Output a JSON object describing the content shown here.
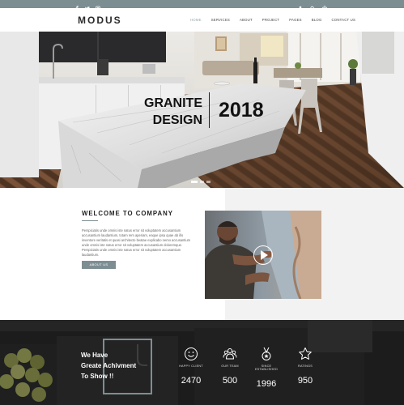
{
  "topbar": {
    "social_icons": [
      "facebook-icon",
      "twitter-icon",
      "instagram-icon"
    ],
    "tool_icons": [
      "user-icon",
      "search-icon",
      "cart-icon"
    ]
  },
  "header": {
    "logo": "MODUS",
    "nav": [
      {
        "label": "HOME",
        "active": true
      },
      {
        "label": "SERVICES",
        "active": false
      },
      {
        "label": "ABOUT",
        "active": false
      },
      {
        "label": "PROJECT",
        "active": false
      },
      {
        "label": "PAGES",
        "active": false
      },
      {
        "label": "BLOG",
        "active": false
      },
      {
        "label": "CONTACT US",
        "active": false
      }
    ]
  },
  "hero": {
    "title_line1": "GRANITE",
    "title_line2": "DESIGN",
    "year": "2018",
    "slides": 3,
    "active_slide": 1
  },
  "welcome": {
    "title": "WELCOME TO COMPANY",
    "text": "Perspiciatis unde omnis iste natus error sit voluptatem accusantium accusantium laudantium, totam rem aperiam, eaque ipsa quae ab illo inventore veritatis et quasi architecto beatae explicabo nemo accusantium unde omnis iste natus error sit voluptatem accusantium doloremque. Perspiciatis unde omnis iste natus error sit voluptatem accusantium laudantium.",
    "button": "ABOUT US",
    "video_icon": "play-icon"
  },
  "stats": {
    "headline": [
      "We Have",
      "Greate Achivment",
      "To Show !!"
    ],
    "items": [
      {
        "icon": "smile-icon",
        "label": "HAPPY CLIENT",
        "value": "2470"
      },
      {
        "icon": "team-icon",
        "label": "OUR TEAM",
        "value": "500"
      },
      {
        "icon": "medal-icon",
        "label": "SINCE ESTABLISHED",
        "value": "1996"
      },
      {
        "icon": "star-icon",
        "label": "RATINGS",
        "value": "950"
      }
    ]
  },
  "colors": {
    "accent": "#7d8e93",
    "dark": "#1f1f1f"
  }
}
